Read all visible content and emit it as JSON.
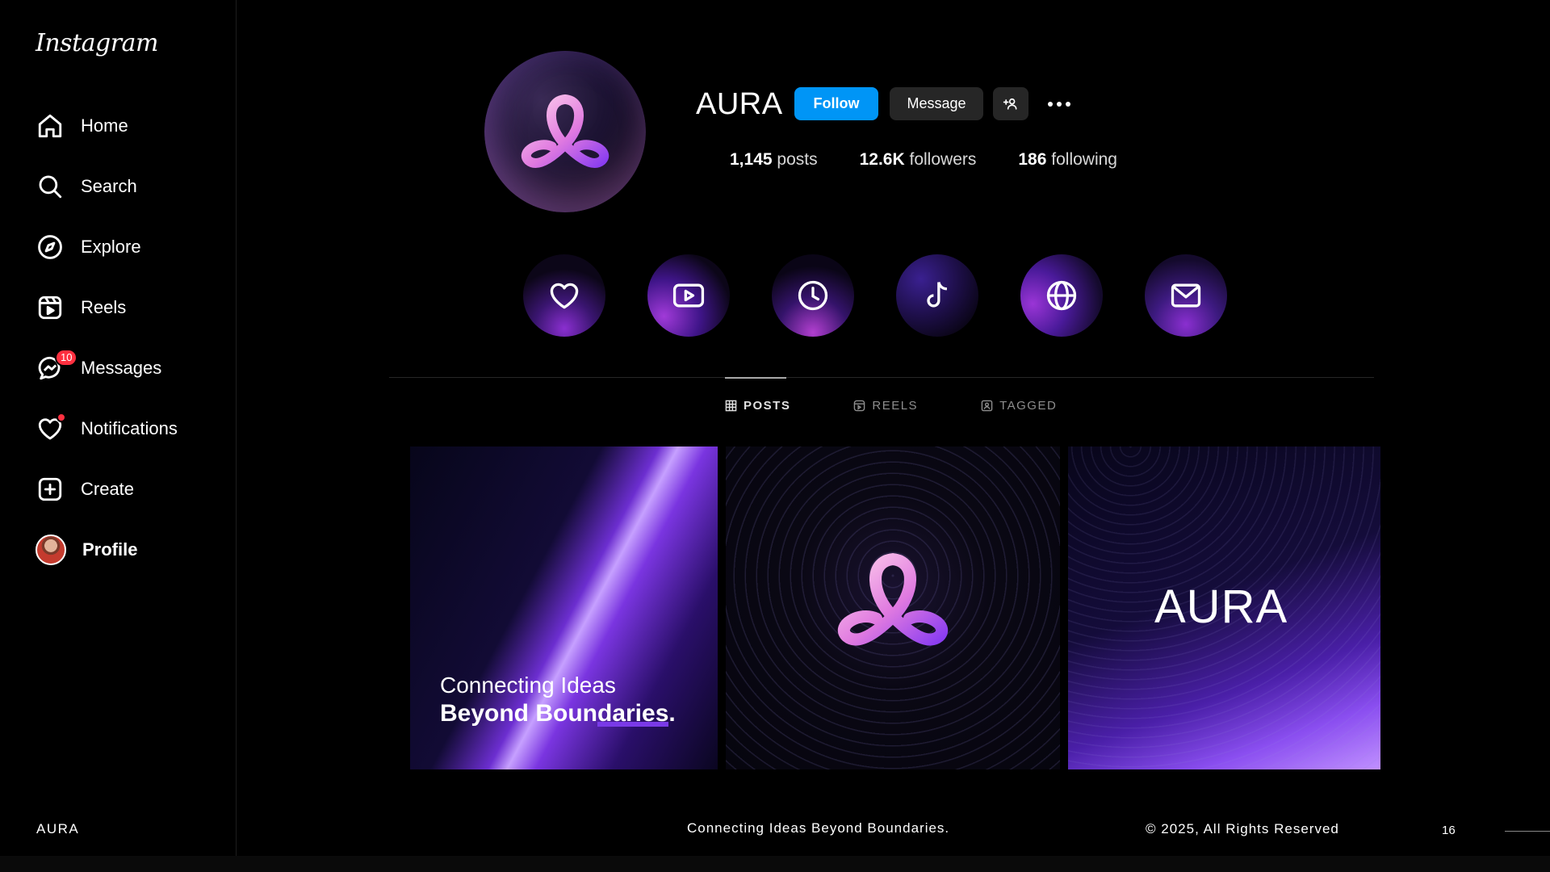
{
  "sidebar": {
    "logo": "Instagram",
    "items": [
      {
        "label": "Home",
        "icon": "home-icon"
      },
      {
        "label": "Search",
        "icon": "search-icon"
      },
      {
        "label": "Explore",
        "icon": "compass-icon"
      },
      {
        "label": "Reels",
        "icon": "reels-icon"
      },
      {
        "label": "Messages",
        "icon": "messenger-icon",
        "badge": "10"
      },
      {
        "label": "Notifications",
        "icon": "heart-icon"
      },
      {
        "label": "Create",
        "icon": "plus-square-icon"
      },
      {
        "label": "Profile",
        "icon": "avatar"
      }
    ]
  },
  "profile": {
    "username": "AURA",
    "follow_label": "Follow",
    "message_label": "Message",
    "stats": {
      "posts_value": "1,145",
      "posts_label": "posts",
      "followers_value": "12.6K",
      "followers_label": "followers",
      "following_value": "186",
      "following_label": "following"
    }
  },
  "highlights": [
    "heart-icon",
    "play-icon",
    "clock-icon",
    "tiktok-icon",
    "globe-icon",
    "mail-icon"
  ],
  "tabs": [
    {
      "label": "POSTS",
      "icon": "grid-icon",
      "active": true
    },
    {
      "label": "REELS",
      "icon": "reels-icon",
      "active": false
    },
    {
      "label": "TAGGED",
      "icon": "tag-user-icon",
      "active": false
    }
  ],
  "posts": {
    "post1_line1": "Connecting Ideas",
    "post1_line2_a": "Beyond Boun",
    "post1_line2_b": "daries",
    "post1_line2_c": ".",
    "post3_word": "AURA"
  },
  "footer": {
    "brand": "AURA",
    "tagline": "Connecting Ideas Beyond Boundaries.",
    "copyright": "© 2025, All Rights Reserved",
    "page": "16"
  },
  "colors": {
    "accent": "#0095f6",
    "badge": "#ff3040",
    "brand_purple": "#7a3ae8"
  }
}
